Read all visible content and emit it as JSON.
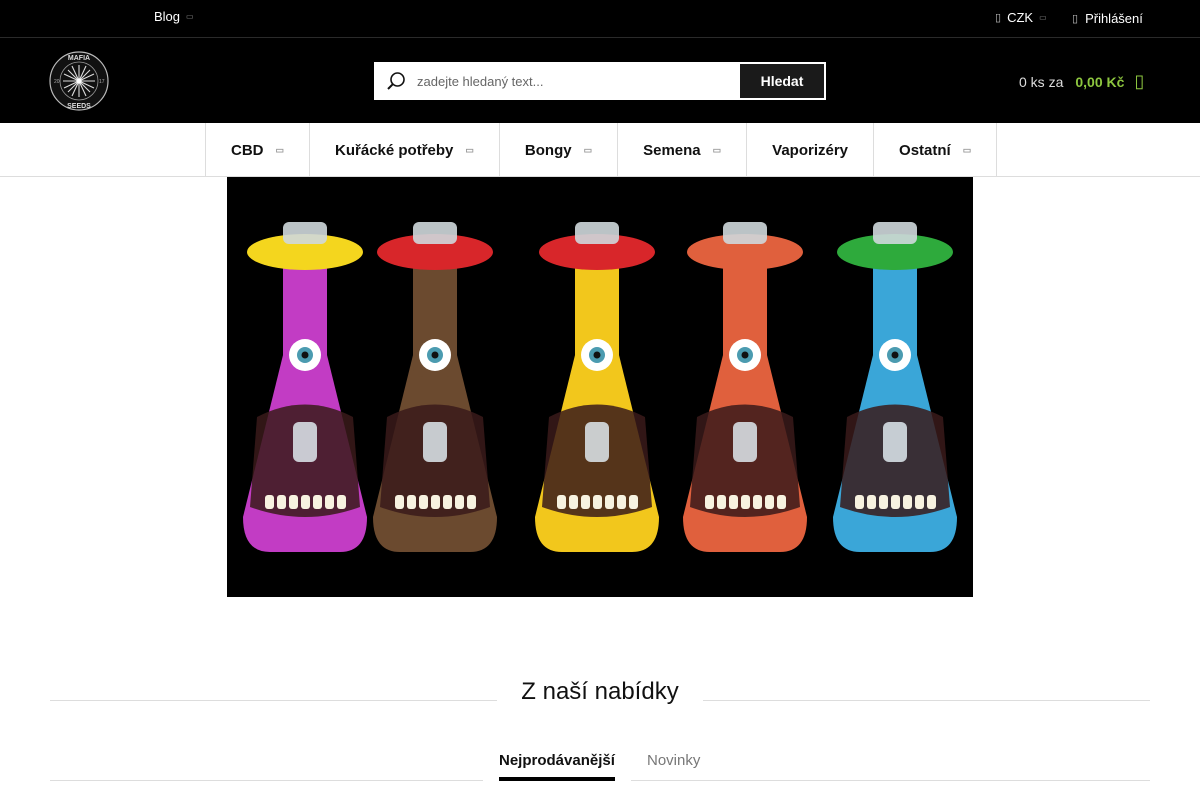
{
  "topbar": {
    "blog_label": "Blog",
    "currency_label": "CZK",
    "login_label": "Přihlášení"
  },
  "header": {
    "logo_text_top": "MAFIA",
    "logo_text_bottom": "SEEDS",
    "logo_left_num": "20",
    "logo_right_num": "17",
    "search_placeholder": "zadejte hledaný text...",
    "search_button": "Hledat",
    "cart_count": "0 ks za",
    "cart_price": "0,00 Kč"
  },
  "nav": {
    "items": [
      {
        "label": "CBD",
        "dropdown": true
      },
      {
        "label": "Kuřácké potřeby",
        "dropdown": true
      },
      {
        "label": "Bongy",
        "dropdown": true
      },
      {
        "label": "Semena",
        "dropdown": true
      },
      {
        "label": "Vaporizéry",
        "dropdown": false
      },
      {
        "label": "Ostatní",
        "dropdown": true
      }
    ]
  },
  "section": {
    "title": "Z naší nabídky",
    "tabs": [
      {
        "label": "Nejprodávanější",
        "active": true
      },
      {
        "label": "Novinky",
        "active": false
      }
    ]
  },
  "colors": {
    "accent_green": "#8dc63f",
    "bong_colors": [
      "#c23cc4",
      "#6b4a2f",
      "#f2c71c",
      "#e0603d",
      "#3aa6d8"
    ],
    "cap_colors": [
      "#f4d61e",
      "#d8262a",
      "#d8262a",
      "#e0603d",
      "#2eaa3c"
    ]
  }
}
